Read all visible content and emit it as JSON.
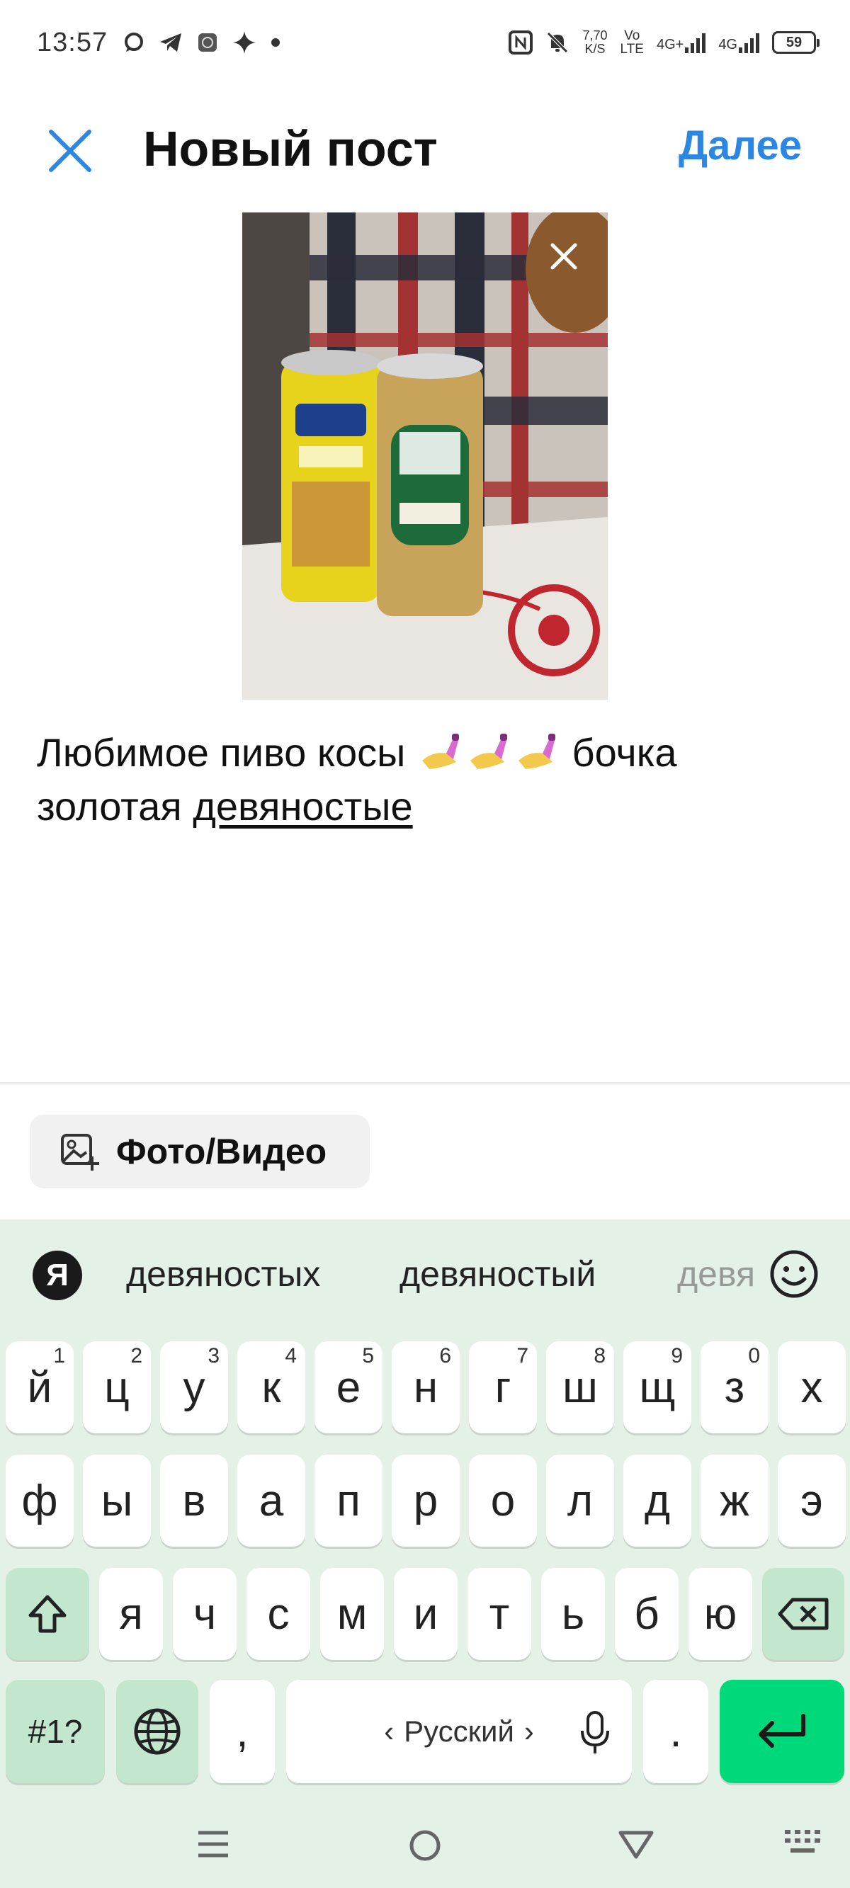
{
  "status_bar": {
    "time": "13:57",
    "speed_value": "7,70",
    "speed_unit": "K/S",
    "volte_top": "Vo",
    "volte_bottom": "LTE",
    "net1": "4G+",
    "net2": "4G",
    "battery": "59"
  },
  "header": {
    "title": "Новый пост",
    "next_label": "Далее",
    "accent_color": "#2d87e2"
  },
  "caption": {
    "text_before_emojis": "Любимое пиво косы",
    "emoji_name": "nail-polish",
    "emoji_count": 3,
    "text_after_emojis": "бочка",
    "line2_plain": "золотая",
    "line2_underlined": "девяностые"
  },
  "attach": {
    "label": "Фото/Видео"
  },
  "keyboard": {
    "logo": "Я",
    "suggestions": [
      "девяностых",
      "девяностый",
      "девя"
    ],
    "row1": [
      {
        "char": "й",
        "sup": "1"
      },
      {
        "char": "ц",
        "sup": "2"
      },
      {
        "char": "у",
        "sup": "3"
      },
      {
        "char": "к",
        "sup": "4"
      },
      {
        "char": "е",
        "sup": "5"
      },
      {
        "char": "н",
        "sup": "6"
      },
      {
        "char": "г",
        "sup": "7"
      },
      {
        "char": "ш",
        "sup": "8"
      },
      {
        "char": "щ",
        "sup": "9"
      },
      {
        "char": "з",
        "sup": "0"
      },
      {
        "char": "х",
        "sup": ""
      }
    ],
    "row2": [
      "ф",
      "ы",
      "в",
      "а",
      "п",
      "р",
      "о",
      "л",
      "д",
      "ж",
      "э"
    ],
    "row3": [
      "я",
      "ч",
      "с",
      "м",
      "и",
      "т",
      "ь",
      "б",
      "ю"
    ],
    "symbols_label": "#1?",
    "comma_label": ",",
    "space_label": "Русский",
    "space_left_arrow": "‹",
    "space_right_arrow": "›",
    "period_label": ".",
    "enter_color": "#00d979"
  }
}
